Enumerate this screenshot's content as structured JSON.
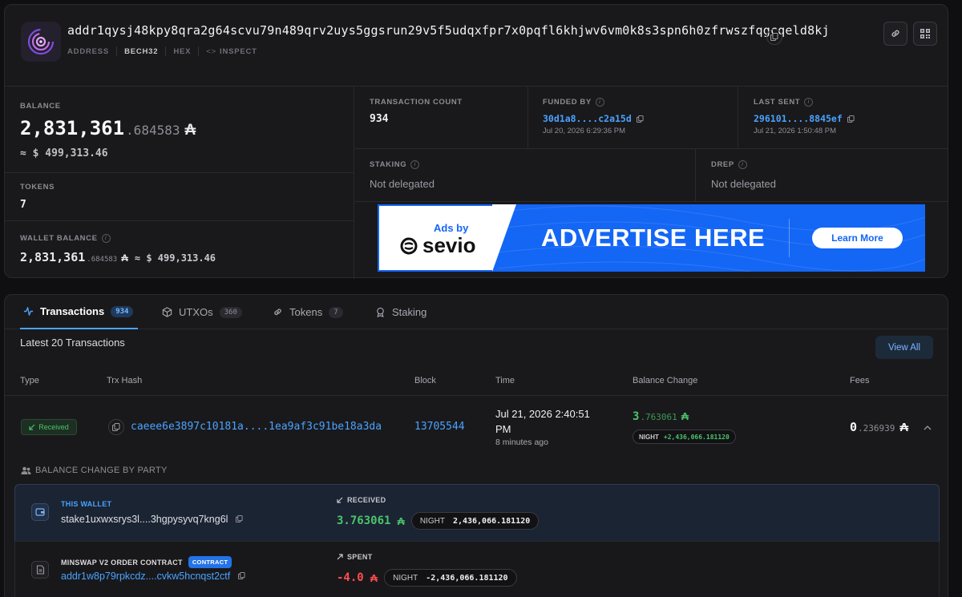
{
  "header": {
    "address": "addr1qysj48kpy8qra2g64scvu79n489qrv2uys5ggsrun29v5f5udqxfpr7x0pqfl6khjwv6vm0k8s3spn6h0zfrwszfqgcqeld8kj",
    "tabs": [
      "ADDRESS",
      "BECH32",
      "HEX",
      "INSPECT"
    ],
    "inspect_icon": "<>"
  },
  "balance": {
    "label": "BALANCE",
    "whole": "2,831,361",
    "decimals": ".684583",
    "symbol": "₳",
    "usd": "≈ $ 499,313.46"
  },
  "tokens": {
    "label": "TOKENS",
    "value": "7"
  },
  "wallet_balance": {
    "label": "WALLET BALANCE",
    "whole": "2,831,361",
    "decimals": ".684583",
    "symbol": "₳",
    "usd": "≈ $ 499,313.46"
  },
  "tx_count": {
    "label": "TRANSACTION COUNT",
    "value": "934"
  },
  "funded_by": {
    "label": "FUNDED BY",
    "hash": "30d1a8....c2a15d",
    "date": "Jul 20, 2026 6:29:36 PM"
  },
  "last_sent": {
    "label": "LAST SENT",
    "hash": "296101....8845ef",
    "date": "Jul 21, 2026 1:50:48 PM"
  },
  "staking": {
    "label": "STAKING",
    "value": "Not delegated"
  },
  "drep": {
    "label": "DREP",
    "value": "Not delegated"
  },
  "ad": {
    "ads_by": "Ads by",
    "brand": "sevio",
    "headline": "ADVERTISE HERE",
    "cta": "Learn More"
  },
  "tabs": [
    {
      "label": "Transactions",
      "count": "934"
    },
    {
      "label": "UTXOs",
      "count": "360"
    },
    {
      "label": "Tokens",
      "count": "7"
    },
    {
      "label": "Staking"
    }
  ],
  "latest_label": "Latest 20 Transactions",
  "view_all": "View All",
  "columns": [
    "Type",
    "Trx Hash",
    "Block",
    "Time",
    "Balance Change",
    "Fees"
  ],
  "tx": {
    "type": "Received",
    "hash": "caeee6e3897c10181a....1ea9af3c91be18a3da",
    "block": "13705544",
    "time_line1": "Jul 21, 2026 2:40:51",
    "time_line2": "PM",
    "ago": "8 minutes ago",
    "change_whole": "3",
    "change_dec": ".763061",
    "token_name": "NIGHT",
    "token_amount": "+2,436,066.181120",
    "fee_whole": "0",
    "fee_dec": ".236939"
  },
  "party_header": "BALANCE CHANGE BY PARTY",
  "parties": [
    {
      "label": "THIS WALLET",
      "address": "stake1uxwxsrys3l....3hgpysyvq7kng6l",
      "direction": "RECEIVED",
      "ada": "3.763061",
      "token_name": "NIGHT",
      "token_amount": "2,436,066.181120"
    },
    {
      "label": "MINSWAP V2 ORDER CONTRACT",
      "badge": "CONTRACT",
      "address": "addr1w8p79rpkcdz....cvkw5hcnqst2ctf",
      "direction": "SPENT",
      "ada": "-4.0",
      "token_name": "NIGHT",
      "token_amount": "-2,436,066.181120"
    }
  ],
  "colors": {
    "accent": "#4aa3ff",
    "positive": "#4cc36b",
    "negative": "#ff4d4d",
    "ad_blue": "#1466f5"
  }
}
